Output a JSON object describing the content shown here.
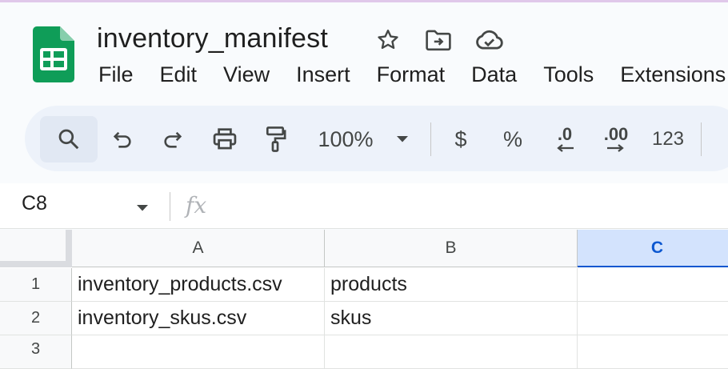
{
  "document": {
    "title": "inventory_manifest",
    "icons": [
      "star-icon",
      "move-to-folder-icon",
      "cloud-saved-icon"
    ]
  },
  "menu": [
    "File",
    "Edit",
    "View",
    "Insert",
    "Format",
    "Data",
    "Tools",
    "Extensions"
  ],
  "toolbar": {
    "zoom": "100%",
    "currency": "$",
    "percent": "%",
    "decrease_decimal": ".0",
    "increase_decimal": ".00",
    "number_format": "123",
    "icons": [
      "search-icon",
      "undo-icon",
      "redo-icon",
      "print-icon",
      "paint-format-icon",
      "chevron-down-icon"
    ]
  },
  "formula_bar": {
    "cell_reference": "C8",
    "fx_label": "fx",
    "formula": ""
  },
  "sheet": {
    "columns": [
      "A",
      "B",
      "C"
    ],
    "selected_column": "C",
    "rows": [
      {
        "number": "1",
        "cells": [
          "inventory_products.csv",
          "products",
          ""
        ]
      },
      {
        "number": "2",
        "cells": [
          "inventory_skus.csv",
          "skus",
          ""
        ]
      },
      {
        "number": "3",
        "cells": [
          "",
          "",
          ""
        ]
      }
    ]
  },
  "colors": {
    "brand_green": "#0f9d58",
    "selection_blue": "#0b57d0",
    "selected_header_bg": "#d3e3fd",
    "toolbar_bg": "#edf2fa"
  }
}
